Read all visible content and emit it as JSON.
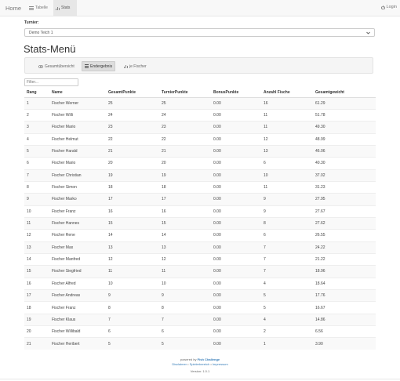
{
  "nav": {
    "brand": "Home",
    "tabs": [
      {
        "label": "Tabelle",
        "icon": "table-icon",
        "active": false
      },
      {
        "label": "Stats",
        "icon": "bar-chart-icon",
        "active": true
      }
    ],
    "login": "Login"
  },
  "turnier": {
    "label": "Turnier:",
    "selected": "Demo Teich 1"
  },
  "page_title": "Stats-Menü",
  "stats_tabs": [
    {
      "label": "Gesamtübersicht",
      "icon": "eye-icon",
      "active": false
    },
    {
      "label": "Endergebnis",
      "icon": "list-icon",
      "active": true
    },
    {
      "label": "je Fischer",
      "icon": "bar-chart-icon",
      "active": false
    }
  ],
  "filter": {
    "placeholder": "Filter..."
  },
  "table": {
    "headers": [
      "Rang",
      "Name",
      "GesamtPunkte",
      "TurnierPunkte",
      "BonusPunkte",
      "Anzahl Fische",
      "Gesamtgewicht"
    ],
    "rows": [
      [
        "1",
        "Fischer Werner",
        "25",
        "25",
        "0.00",
        "16",
        "61.29"
      ],
      [
        "2",
        "Fischer Willi",
        "24",
        "24",
        "0.00",
        "11",
        "51.78"
      ],
      [
        "3",
        "Fischer Mario",
        "23",
        "23",
        "0.00",
        "11",
        "49.30"
      ],
      [
        "4",
        "Fischer Helmut",
        "22",
        "22",
        "0.00",
        "12",
        "48.99"
      ],
      [
        "5",
        "Fischer Harald",
        "21",
        "21",
        "0.00",
        "13",
        "46.06"
      ],
      [
        "6",
        "Fischer Mario",
        "20",
        "20",
        "0.00",
        "6",
        "40.30"
      ],
      [
        "7",
        "Fischer Christian",
        "19",
        "19",
        "0.00",
        "10",
        "37.02"
      ],
      [
        "8",
        "Fischer Simon",
        "18",
        "18",
        "0.00",
        "11",
        "31.23"
      ],
      [
        "9",
        "Fischer Marko",
        "17",
        "17",
        "0.00",
        "9",
        "27.95"
      ],
      [
        "10",
        "Fischer Franz",
        "16",
        "16",
        "0.00",
        "9",
        "27.67"
      ],
      [
        "11",
        "Fischer Hannes",
        "15",
        "15",
        "0.00",
        "8",
        "27.62"
      ],
      [
        "12",
        "Fischer Rene",
        "14",
        "14",
        "0.00",
        "6",
        "26.55"
      ],
      [
        "13",
        "Fischer Max",
        "13",
        "13",
        "0.00",
        "7",
        "24.22"
      ],
      [
        "14",
        "Fischer Manfred",
        "12",
        "12",
        "0.00",
        "7",
        "21.22"
      ],
      [
        "15",
        "Fischer Siegfried",
        "11",
        "11",
        "0.00",
        "7",
        "18.96"
      ],
      [
        "16",
        "Fischer Alfred",
        "10",
        "10",
        "0.00",
        "4",
        "18.64"
      ],
      [
        "17",
        "Fischer Andreas",
        "9",
        "9",
        "0.00",
        "5",
        "17.76"
      ],
      [
        "18",
        "Fischer Franz",
        "8",
        "8",
        "0.00",
        "5",
        "16.67"
      ],
      [
        "19",
        "Fischer Klaus",
        "7",
        "7",
        "0.00",
        "4",
        "14.86"
      ],
      [
        "20",
        "Fischer Willibald",
        "6",
        "6",
        "0.00",
        "2",
        "6.56"
      ],
      [
        "21",
        "Fischer Heribert",
        "5",
        "5",
        "0.00",
        "1",
        "3.90"
      ]
    ]
  },
  "footer": {
    "powered_by": "powered by",
    "brand": "Fish Challenge",
    "links": [
      "Disclaimer",
      "Spielerbereich",
      "Impressum"
    ],
    "separator": "•",
    "version": "Version: 1.0.1"
  }
}
